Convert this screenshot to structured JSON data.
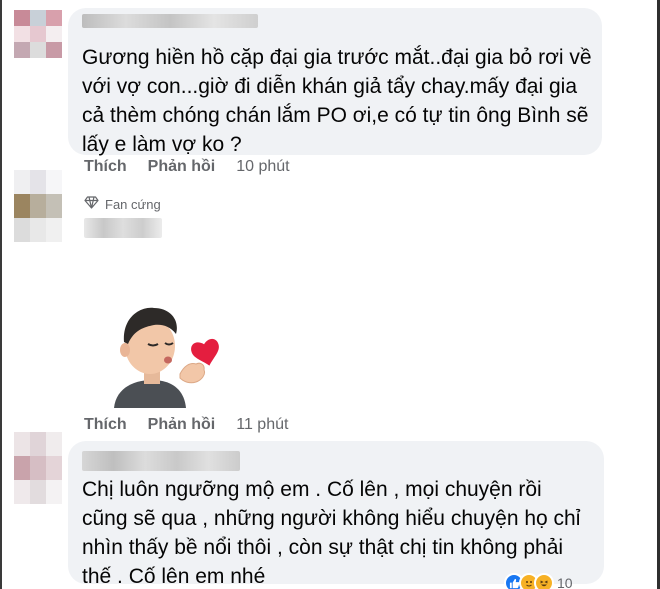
{
  "comments": [
    {
      "text": "Gương hiền hồ cặp đại gia trước mắt..đại gia bỏ rơi về với vợ con...giờ đi diễn khán giả tẩy chay.mấy đại gia cả thèm chóng chán lắm PO ơi,e có tự tin ông Bình sẽ lấy e làm vợ ko ?",
      "like_label": "Thích",
      "reply_label": "Phản hồi",
      "time": "10 phút"
    },
    {
      "badge": "Fan cứng",
      "like_label": "Thích",
      "reply_label": "Phản hồi",
      "time": "11 phút"
    },
    {
      "text": "Chị luôn ngưỡng mộ em . Cố lên , mọi chuyện rồi cũng sẽ qua , những người không hiểu chuyện họ chỉ nhìn thấy bề nổi thôi , còn sự thật chị tin không phải thế . Cố lên em nhé",
      "reaction_count": "10"
    }
  ],
  "icons": {
    "badge": "diamond-icon",
    "sticker": "blowing-kiss-avatar-sticker",
    "reactions": [
      "like-reaction-icon",
      "care-reaction-icon",
      "haha-reaction-icon"
    ]
  },
  "colors": {
    "bubble": "#f0f2f5",
    "secondary_text": "#65676b",
    "like_blue": "#1877f2",
    "heart_red": "#e41e3f"
  }
}
